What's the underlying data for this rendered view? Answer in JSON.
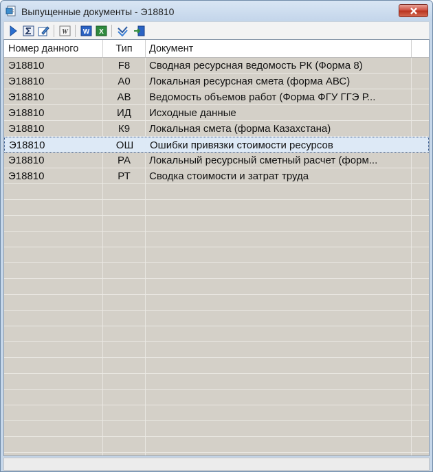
{
  "window": {
    "title": "Выпущенные документы - Э18810"
  },
  "toolbar": {
    "buttons": [
      {
        "name": "run-icon"
      },
      {
        "name": "sum-icon"
      },
      {
        "name": "edit-icon"
      },
      {
        "name": "wordpad-icon"
      },
      {
        "name": "word-icon"
      },
      {
        "name": "excel-icon"
      },
      {
        "name": "check-icon"
      },
      {
        "name": "export-icon"
      }
    ]
  },
  "table": {
    "columns": [
      "Номер данного",
      "Тип",
      "Документ"
    ],
    "rows": [
      {
        "number": "Э18810",
        "type": "F8",
        "document": "Сводная ресурсная ведомость РК (Форма 8)"
      },
      {
        "number": "Э18810",
        "type": "А0",
        "document": "Локальная ресурсная смета (форма АВС)"
      },
      {
        "number": "Э18810",
        "type": "АВ",
        "document": "Ведомость объемов работ (Форма ФГУ ГГЭ Р..."
      },
      {
        "number": "Э18810",
        "type": "ИД",
        "document": "Исходные данные"
      },
      {
        "number": "Э18810",
        "type": "К9",
        "document": "Локальная смета (форма Казахстана)"
      },
      {
        "number": "Э18810",
        "type": "ОШ",
        "document": "Ошибки привязки стоимости ресурсов"
      },
      {
        "number": "Э18810",
        "type": "РА",
        "document": "Локальный ресурсный сметный расчет (форм..."
      },
      {
        "number": "Э18810",
        "type": "РТ",
        "document": "Сводка стоимости и затрат труда"
      }
    ],
    "selected_index": 5
  },
  "colors": {
    "selection": "#dde9f6",
    "grid_bg": "#d4d0c8",
    "close": "#cc4a3a"
  }
}
